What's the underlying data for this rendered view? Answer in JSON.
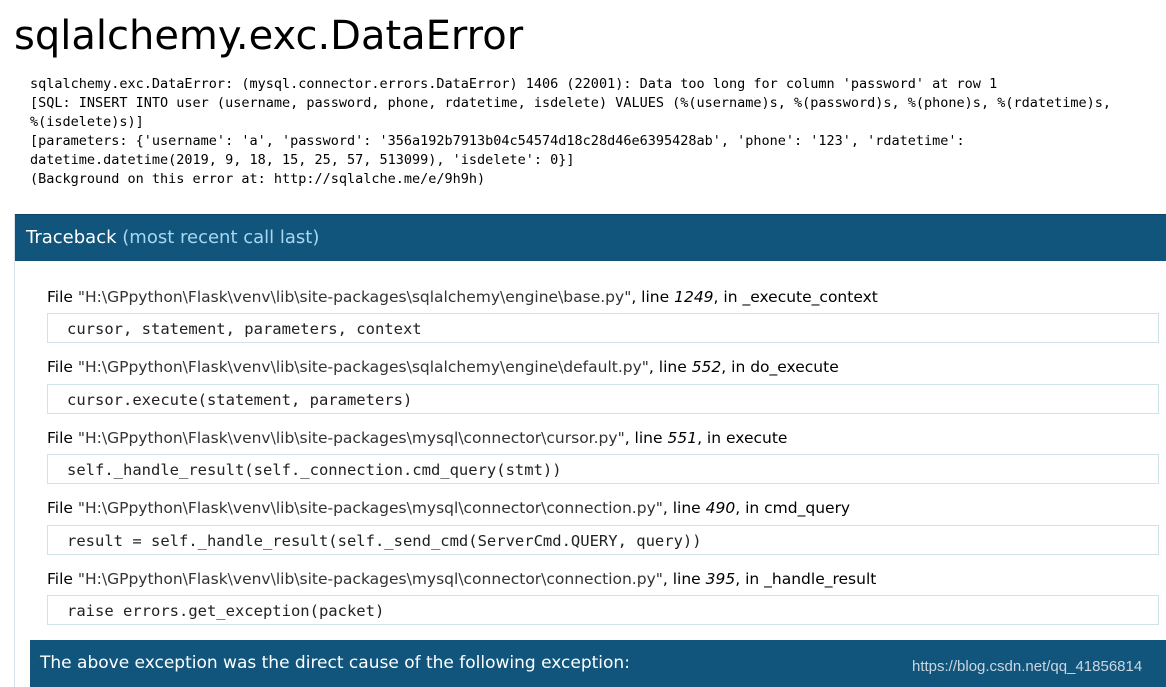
{
  "title": "sqlalchemy.exc.DataError",
  "error_message": "sqlalchemy.exc.DataError: (mysql.connector.errors.DataError) 1406 (22001): Data too long for column 'password' at row 1\n[SQL: INSERT INTO user (username, password, phone, rdatetime, isdelete) VALUES (%(username)s, %(password)s, %(phone)s, %(rdatetime)s, %(isdelete)s)]\n[parameters: {'username': 'a', 'password': '356a192b7913b04c54574d18c28d46e6395428ab', 'phone': '123', 'rdatetime': datetime.datetime(2019, 9, 18, 15, 25, 57, 513099), 'isdelete': 0}]\n(Background on this error at: http://sqlalche.me/e/9h9h)",
  "traceback": {
    "heading": "Traceback",
    "subheading": "(most recent call last)",
    "frames": [
      {
        "file_prefix": "File ",
        "filename": "\"H:\\GPpython\\Flask\\venv\\lib\\site-packages\\sqlalchemy\\engine\\base.py\"",
        "line_prefix": ", line ",
        "lineno": "1249",
        "func_prefix": ", in ",
        "function": "_execute_context",
        "code": "cursor, statement, parameters, context"
      },
      {
        "file_prefix": "File ",
        "filename": "\"H:\\GPpython\\Flask\\venv\\lib\\site-packages\\sqlalchemy\\engine\\default.py\"",
        "line_prefix": ", line ",
        "lineno": "552",
        "func_prefix": ", in ",
        "function": "do_execute",
        "code": "cursor.execute(statement, parameters)"
      },
      {
        "file_prefix": "File ",
        "filename": "\"H:\\GPpython\\Flask\\venv\\lib\\site-packages\\mysql\\connector\\cursor.py\"",
        "line_prefix": ", line ",
        "lineno": "551",
        "func_prefix": ", in ",
        "function": "execute",
        "code": "self._handle_result(self._connection.cmd_query(stmt))"
      },
      {
        "file_prefix": "File ",
        "filename": "\"H:\\GPpython\\Flask\\venv\\lib\\site-packages\\mysql\\connector\\connection.py\"",
        "line_prefix": ", line ",
        "lineno": "490",
        "func_prefix": ", in ",
        "function": "cmd_query",
        "code": "result = self._handle_result(self._send_cmd(ServerCmd.QUERY, query))"
      },
      {
        "file_prefix": "File ",
        "filename": "\"H:\\GPpython\\Flask\\venv\\lib\\site-packages\\mysql\\connector\\connection.py\"",
        "line_prefix": ", line ",
        "lineno": "395",
        "func_prefix": ", in ",
        "function": "_handle_result",
        "code": "raise errors.get_exception(packet)"
      }
    ]
  },
  "cause_banner": "The above exception was the direct cause of the following exception:",
  "watermark": "https://blog.csdn.net/qq_41856814",
  "colors": {
    "header_bg": "#11557c",
    "header_subtext": "#a8d7f0",
    "code_border": "#d2e2ea"
  }
}
